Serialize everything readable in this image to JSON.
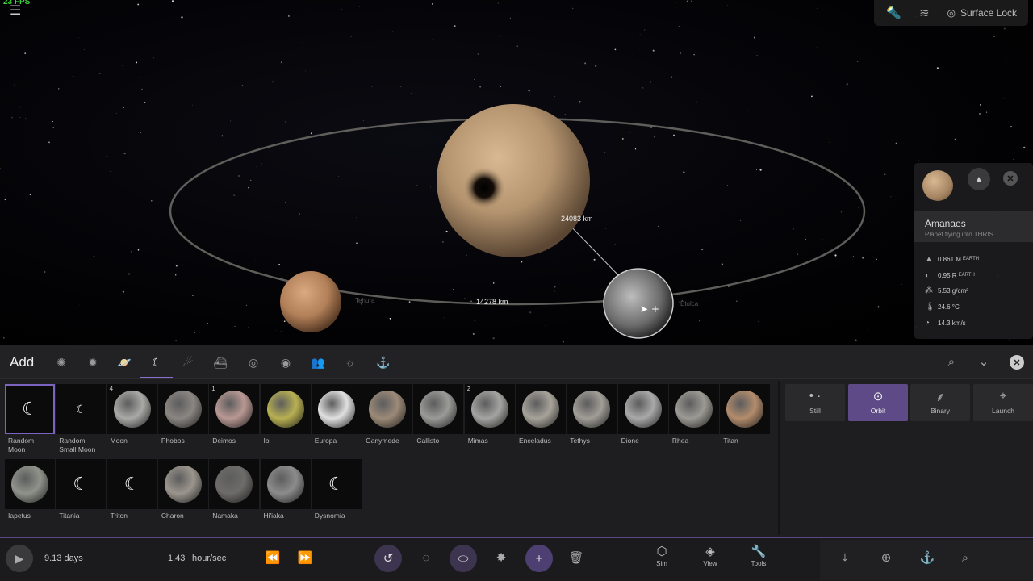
{
  "hud": {
    "fps": "23 FPS",
    "surface_lock": "Surface Lock"
  },
  "scene": {
    "distance_main": "24083 km",
    "distance_orbit": "14278 km",
    "label_left": "Tehura",
    "label_right": "Etolca"
  },
  "info": {
    "name": "Amanaes",
    "subtitle": "Planet flying into THRIS",
    "mass_value": "0.861 M",
    "mass_unit": "EARTH",
    "radius_value": "0.95 R",
    "radius_unit": "EARTH",
    "density": "5.53 g/cm³",
    "temperature": "24.6 °C",
    "velocity": "14.3 km/s"
  },
  "add_panel": {
    "title": "Add",
    "tiles": [
      {
        "label": "Random\nMoon",
        "count": "",
        "kind": "crescent",
        "color": ""
      },
      {
        "label": "Random\nSmall Moon",
        "count": "",
        "kind": "crescent-small",
        "color": ""
      },
      {
        "label": "Moon",
        "count": "4",
        "kind": "ball",
        "color": "#a9a9a6"
      },
      {
        "label": "Phobos",
        "count": "",
        "kind": "ball",
        "color": "#8b8682"
      },
      {
        "label": "Deimos",
        "count": "1",
        "kind": "ball",
        "color": "#b99893"
      },
      {
        "label": "Io",
        "count": "",
        "kind": "ball",
        "color": "#b8b052"
      },
      {
        "label": "Europa",
        "count": "",
        "kind": "ball",
        "color": "#e0e0e0"
      },
      {
        "label": "Ganymede",
        "count": "",
        "kind": "ball",
        "color": "#9c8a78"
      },
      {
        "label": "Callisto",
        "count": "",
        "kind": "ball",
        "color": "#9a9a98"
      },
      {
        "label": "Mimas",
        "count": "2",
        "kind": "ball",
        "color": "#a4a4a2"
      },
      {
        "label": "Enceladus",
        "count": "",
        "kind": "ball",
        "color": "#a7a39a"
      },
      {
        "label": "Tethys",
        "count": "",
        "kind": "ball",
        "color": "#a19d97"
      },
      {
        "label": "Dione",
        "count": "",
        "kind": "ball",
        "color": "#a9a9a9"
      },
      {
        "label": "Rhea",
        "count": "",
        "kind": "ball",
        "color": "#9c9a94"
      },
      {
        "label": "Titan",
        "count": "",
        "kind": "ball",
        "color": "#b38c6c"
      },
      {
        "label": "Iapetus",
        "count": "",
        "kind": "ball",
        "color": "#8f938b"
      },
      {
        "label": "Titania",
        "count": "",
        "kind": "crescent",
        "color": ""
      },
      {
        "label": "Triton",
        "count": "",
        "kind": "crescent",
        "color": ""
      },
      {
        "label": "Charon",
        "count": "",
        "kind": "ball",
        "color": "#9b958d"
      },
      {
        "label": "Namaka",
        "count": "",
        "kind": "ball",
        "color": "#6e6c6a"
      },
      {
        "label": "Hi'iaka",
        "count": "",
        "kind": "ball",
        "color": "#8c8c8c"
      },
      {
        "label": "Dysnomia",
        "count": "",
        "kind": "crescent",
        "color": ""
      }
    ],
    "modes": [
      {
        "label": "Still",
        "icon": "still-icon"
      },
      {
        "label": "Orbit",
        "icon": "orbit-icon"
      },
      {
        "label": "Binary",
        "icon": "binary-icon"
      },
      {
        "label": "Launch",
        "icon": "launch-icon"
      }
    ]
  },
  "bottom": {
    "elapsed": "9.13 days",
    "rate_value": "1.43",
    "rate_unit": "hour/sec",
    "sim_label": "Sim",
    "view_label": "View",
    "tools_label": "Tools"
  },
  "colors": {
    "accent": "#5d4a86",
    "accent_line": "#8a6fd1",
    "fps": "#39d439"
  }
}
